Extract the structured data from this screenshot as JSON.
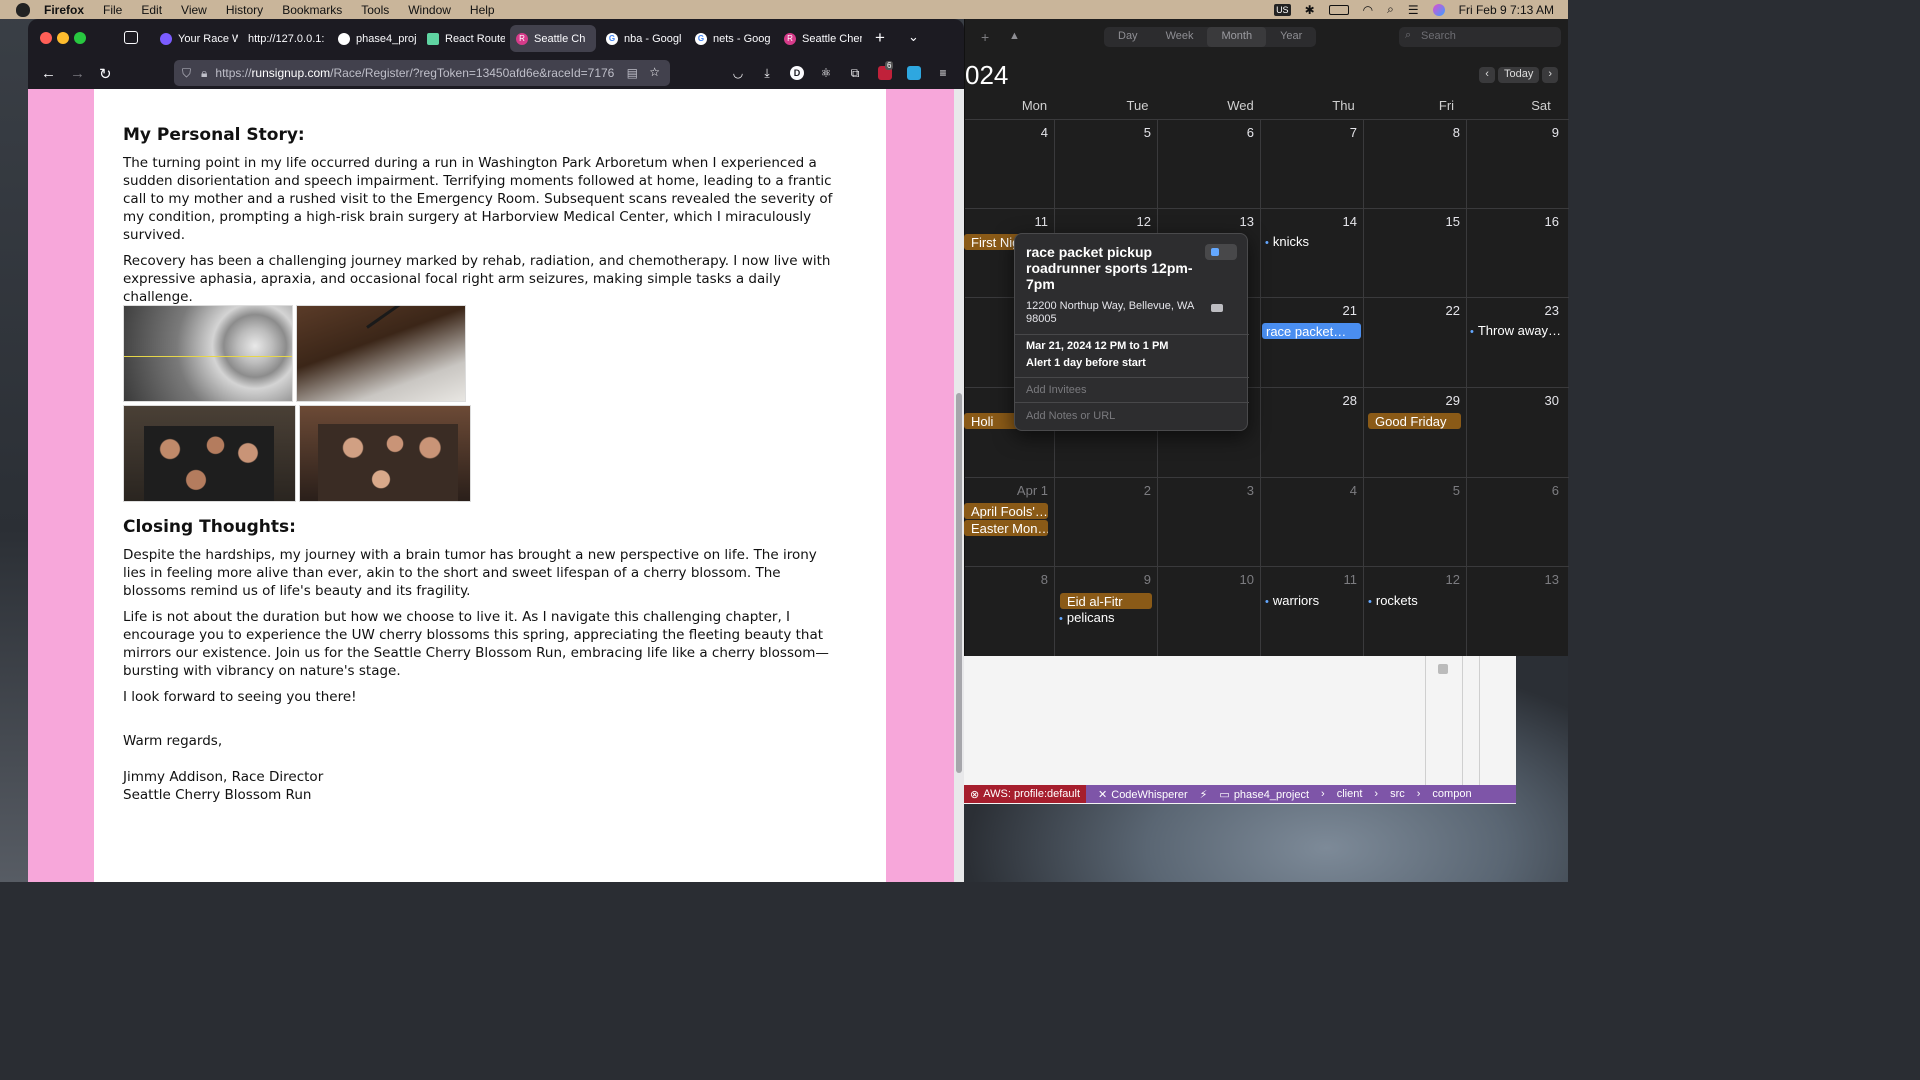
{
  "menubar": {
    "app": "Firefox",
    "items": [
      "File",
      "Edit",
      "View",
      "History",
      "Bookmarks",
      "Tools",
      "Window",
      "Help"
    ],
    "datetime": "Fri Feb 9  7:13 AM",
    "input_source": "US"
  },
  "browser": {
    "tabs": [
      {
        "label": "Your Race W",
        "favicon": "race-icon",
        "color": "#7b5cff"
      },
      {
        "label": "http://127.0.0.1:5",
        "favicon": "",
        "color": ""
      },
      {
        "label": "phase4_proj",
        "favicon": "github-icon",
        "color": "#fff"
      },
      {
        "label": "React Route",
        "favicon": "react-router-icon",
        "color": "#5fd4a2"
      },
      {
        "label": "Seattle Ch",
        "favicon": "runsignup-icon",
        "color": "#d63b8a",
        "active": true
      },
      {
        "label": "nba - Googl",
        "favicon": "google-icon",
        "color": "#4285f4"
      },
      {
        "label": "nets - Goog",
        "favicon": "google-icon",
        "color": "#4285f4"
      },
      {
        "label": "Seattle Cher",
        "favicon": "runsignup-icon",
        "color": "#d63b8a"
      }
    ],
    "url_prefix": "https://",
    "url_host": "runsignup.com",
    "url_path": "/Race/Register/?regToken=13450afd6e&raceId=7176",
    "extension_badge": "6"
  },
  "page": {
    "story_heading": "My Personal Story:",
    "story_p1": "The turning point in my life occurred during a run in Washington Park Arboretum when I experienced a sudden disorientation and speech impairment. Terrifying moments followed at home, leading to a frantic call to my mother and a rushed visit to the Emergency Room. Subsequent scans revealed the severity of my condition, prompting a high-risk brain surgery at Harborview Medical Center, which I miraculously survived.",
    "story_p2": "Recovery has been a challenging journey marked by rehab, radiation, and chemotherapy. I now live with expressive aphasia, apraxia, and occasional focal right arm seizures, making simple tasks a daily challenge.",
    "closing_heading": "Closing Thoughts:",
    "closing_p1": "Despite the hardships, my journey with a brain tumor has brought a new perspective on life. The irony lies in feeling more alive than ever, akin to the short and sweet lifespan of a cherry blossom. The blossoms remind us of life's beauty and its fragility.",
    "closing_p2": "Life is not about the duration but how we choose to live it. As I navigate this challenging chapter, I encourage you to experience the UW cherry blossoms this spring, appreciating the fleeting beauty that mirrors our existence. Join us for the Seattle Cherry Blossom Run, embracing life like a cherry blossom—bursting with vibrancy on nature's stage.",
    "closing_p3": "I look forward to seeing you there!",
    "signoff": "Warm regards,",
    "signature_name": "Jimmy Addison, Race Director",
    "signature_org": "Seattle Cherry Blossom Run"
  },
  "calendar": {
    "views": [
      "Day",
      "Week",
      "Month",
      "Year"
    ],
    "active_view": "Month",
    "search_placeholder": "Search",
    "year_fragment": "024",
    "today_label": "Today",
    "weekdays": [
      "Mon",
      "Tue",
      "Wed",
      "Thu",
      "Fri",
      "Sat"
    ],
    "weeks": [
      [
        "4",
        "5",
        "6",
        "7",
        "8",
        "9"
      ],
      [
        "11",
        "12",
        "13",
        "14",
        "15",
        "16"
      ],
      [
        "",
        "",
        "",
        "21",
        "22",
        "23"
      ],
      [
        "",
        "",
        "",
        "28",
        "29",
        "30"
      ],
      [
        "Apr 1",
        "2",
        "3",
        "4",
        "5",
        "6"
      ],
      [
        "8",
        "9",
        "10",
        "11",
        "12",
        "13"
      ]
    ],
    "events": {
      "first_night": "First Nig",
      "knicks": "knicks",
      "race_packet": "race packet…",
      "throw_away": "Throw away…",
      "holi": "Holi",
      "good_friday": "Good Friday",
      "april_fools": "April Fools'…",
      "easter_monday": "Easter Mon…",
      "eid": "Eid al-Fitr",
      "pelicans": "pelicans",
      "warriors": "warriors",
      "rockets": "rockets"
    },
    "popup": {
      "title": "race packet pickup roadrunner sports 12pm-7pm",
      "address": "12200 Northup Way, Bellevue, WA 98005",
      "date": "Mar 21, 2024  12 PM to 1 PM",
      "alert": "Alert 1 day before start",
      "invitees_placeholder": "Add Invitees",
      "notes_placeholder": "Add Notes or URL"
    }
  },
  "vscode_status": {
    "aws": "AWS: profile:default",
    "codewhisperer": "CodeWhisperer",
    "project": "phase4_project",
    "crumbs": [
      "client",
      "src",
      "compon"
    ]
  }
}
